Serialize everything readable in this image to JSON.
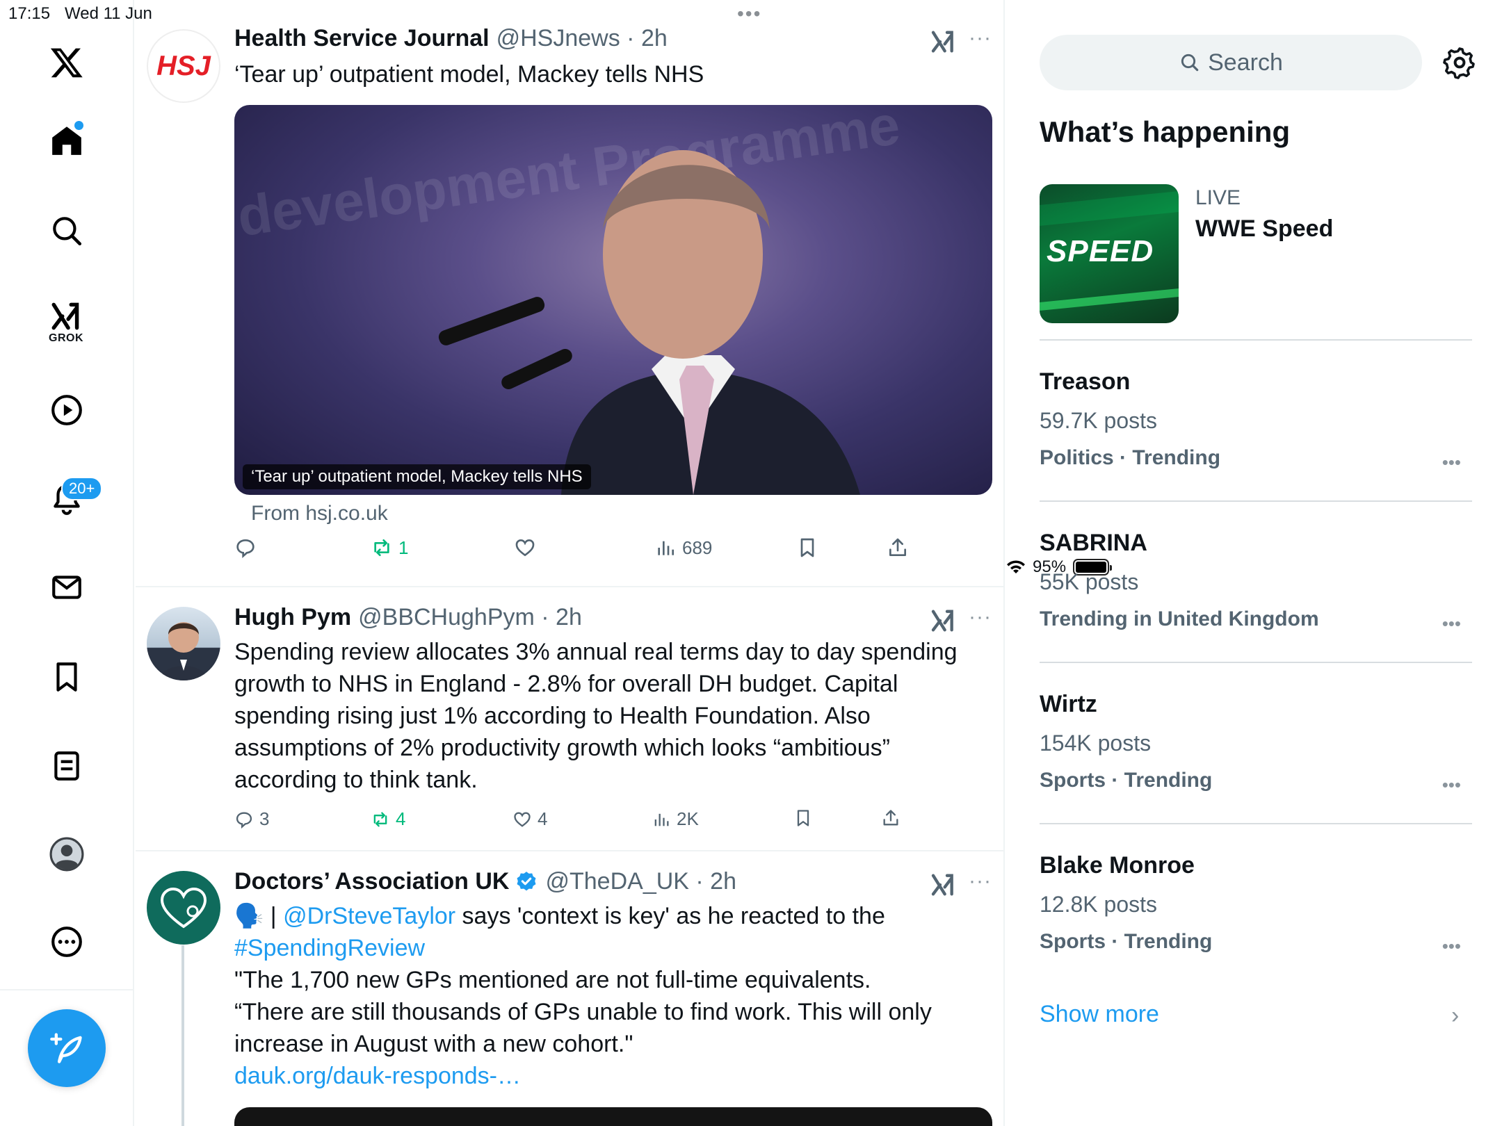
{
  "status": {
    "time": "17:15",
    "date": "Wed 11 Jun",
    "battery": "95%"
  },
  "nav": {
    "grok_label": "GROK",
    "notifications_badge": "20+"
  },
  "posts": [
    {
      "name": "Health Service Journal",
      "handle": "@HSJnews · 2h",
      "text": "‘Tear up’ outpatient model, Mackey tells NHS",
      "media_caption": "‘Tear up’ outpatient model, Mackey tells NHS",
      "media_bg_text": "development Programme",
      "from": "From hsj.co.uk",
      "avatar_text": "HSJ",
      "reposts": "1",
      "views": "689"
    },
    {
      "name": "Hugh Pym",
      "handle": "@BBCHughPym · 2h",
      "text": "Spending review allocates 3% annual real terms day to day spending growth to NHS in England - 2.8% for overall DH budget. Capital spending rising just 1% according to Health Foundation. Also assumptions of 2% productivity growth which looks “ambitious” according to think tank.",
      "replies": "3",
      "reposts": "4",
      "likes": "4",
      "views": "2K"
    },
    {
      "name": "Doctors’ Association UK",
      "handle": "@TheDA_UK · 2h",
      "emoji": "🗣️",
      "prefix": " | ",
      "mention": "@DrSteveTaylor",
      "text_after_mention": " says 'context is key' as he reacted to the",
      "hashtag": "#SpendingReview",
      "quote1": "\"The 1,700 new GPs mentioned are not full-time equivalents.",
      "quote2": "“There are still thousands of GPs unable to find work. This will only increase in August with a new cohort.\"",
      "link": "dauk.org/dauk-responds-…"
    }
  ],
  "sidebar": {
    "search_placeholder": "Search",
    "whats_happening": "What’s happening",
    "live_label": "LIVE",
    "live_title": "WWE Speed",
    "live_thumb_text": "SPEED",
    "trends": [
      {
        "name": "Treason",
        "count": "59.7K posts",
        "category": "Politics · Trending"
      },
      {
        "name": "SABRINA",
        "count": "55K posts",
        "category": "Trending in United Kingdom"
      },
      {
        "name": "Wirtz",
        "count": "154K posts",
        "category": "Sports · Trending"
      },
      {
        "name": "Blake Monroe",
        "count": "12.8K posts",
        "category": "Sports · Trending"
      }
    ],
    "show_more": "Show more"
  },
  "colors": {
    "accent": "#1d9bf0",
    "repost_active": "#00ba7c",
    "secondary_text": "#536471"
  }
}
